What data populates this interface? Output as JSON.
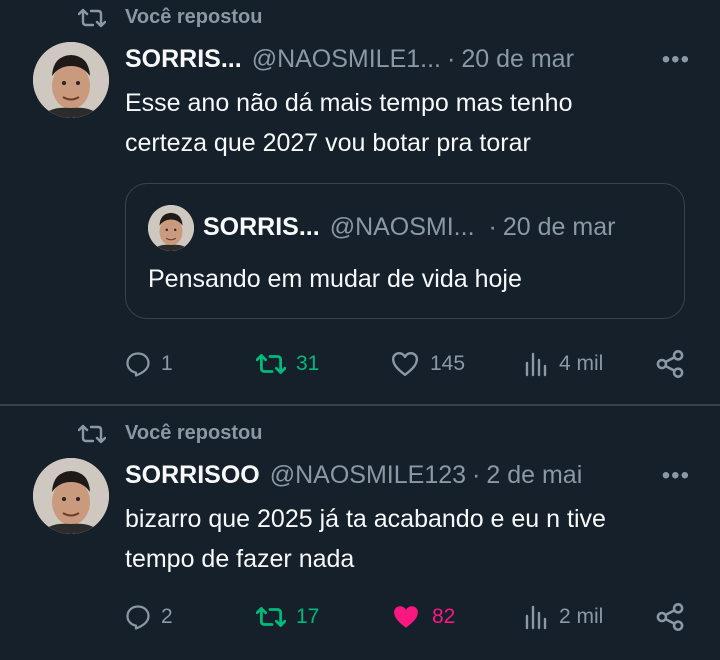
{
  "posts": [
    {
      "repost_label": "Você repostou",
      "author_name": "SORRIS...",
      "handle": "@NAOSMILE1...",
      "separator": "·",
      "date": "20 de mar",
      "more": "•••",
      "text_line1": "Esse ano não dá mais tempo mas tenho",
      "text_line2": "certeza que 2027 vou botar pra torar",
      "quote": {
        "author_name": "SORRIS...",
        "handle": "@NAOSMI...",
        "separator": "·",
        "date": "20 de mar",
        "text": "Pensando em mudar de vida hoje"
      },
      "replies": "1",
      "reposts": "31",
      "likes": "145",
      "views": "4 mil",
      "reposted": true,
      "liked": false
    },
    {
      "repost_label": "Você repostou",
      "author_name": "SORRISOO",
      "handle": "@NAOSMILE123",
      "separator": "·",
      "date": "2 de mai",
      "more": "•••",
      "text_line1": "bizarro que 2025 já ta acabando e eu n tive",
      "text_line2": "tempo de fazer nada",
      "replies": "2",
      "reposts": "17",
      "likes": "82",
      "views": "2 mil",
      "reposted": true,
      "liked": true
    }
  ],
  "colors": {
    "background": "#15202b",
    "secondary_text": "#8b98a5",
    "repost_green": "#00ba7c",
    "like_pink": "#f91880",
    "border": "#38444d"
  }
}
